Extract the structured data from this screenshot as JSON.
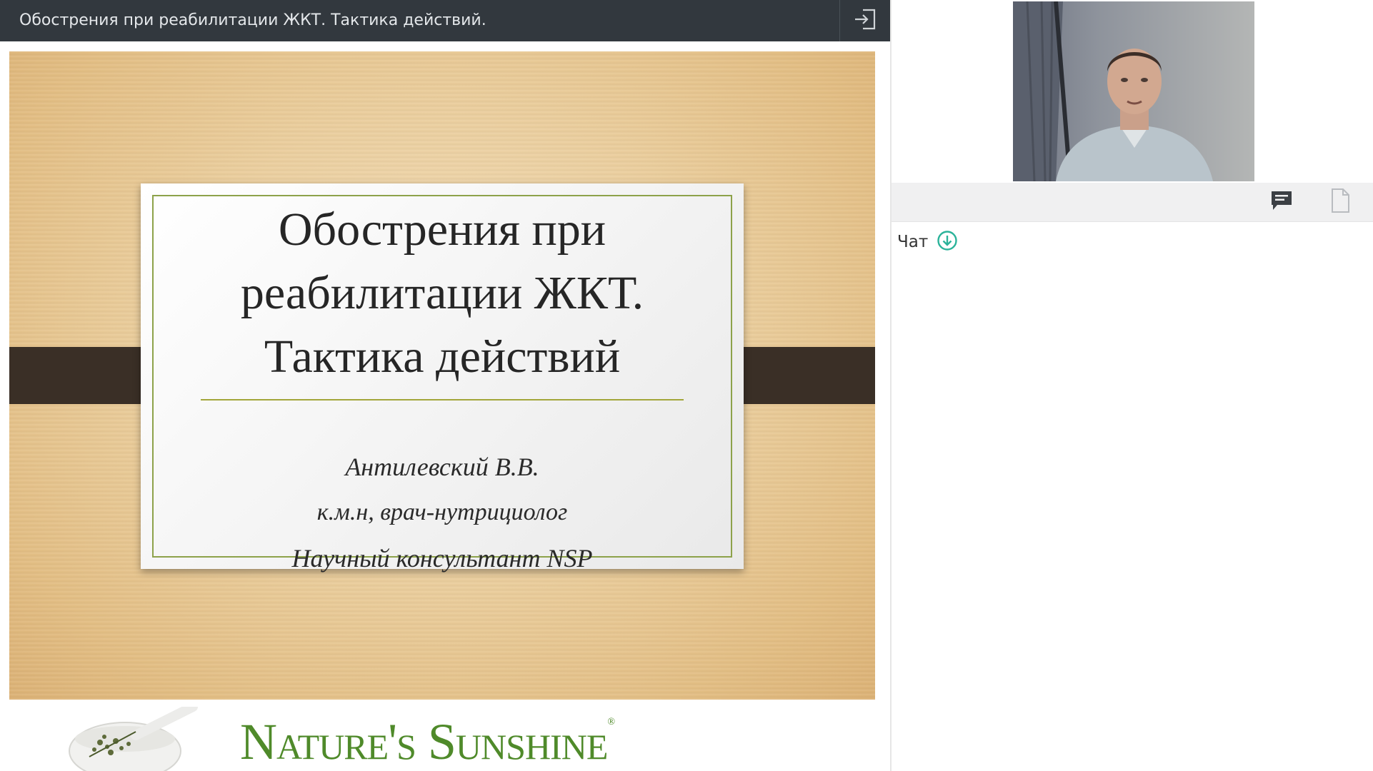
{
  "header": {
    "title": "Обострения при реабилитации ЖКТ. Тактика действий.",
    "exit_icon": "exit-icon"
  },
  "slide": {
    "title_lines": [
      "Обострения при",
      "реабилитации ЖКТ.",
      "Тактика действий"
    ],
    "author_name": "Антилевский В.В.",
    "author_degree": "к.м.н, врач-нутрициолог",
    "author_role": "Научный консультант NSP"
  },
  "footer": {
    "brand_name": "Nature's Sunshine",
    "brand_mark": "®",
    "brand_color": "#4f8a2a"
  },
  "sidebar": {
    "tabs": [
      {
        "icon": "chat-icon",
        "active": true
      },
      {
        "icon": "file-icon",
        "active": false
      }
    ],
    "chat_label": "Чат",
    "chat_download_icon": "download-icon",
    "accent_color": "#2bb39a"
  },
  "colors": {
    "top_bar": "#32383e",
    "slide_frame": "#8da24a",
    "slide_band": "#3a2f26"
  }
}
